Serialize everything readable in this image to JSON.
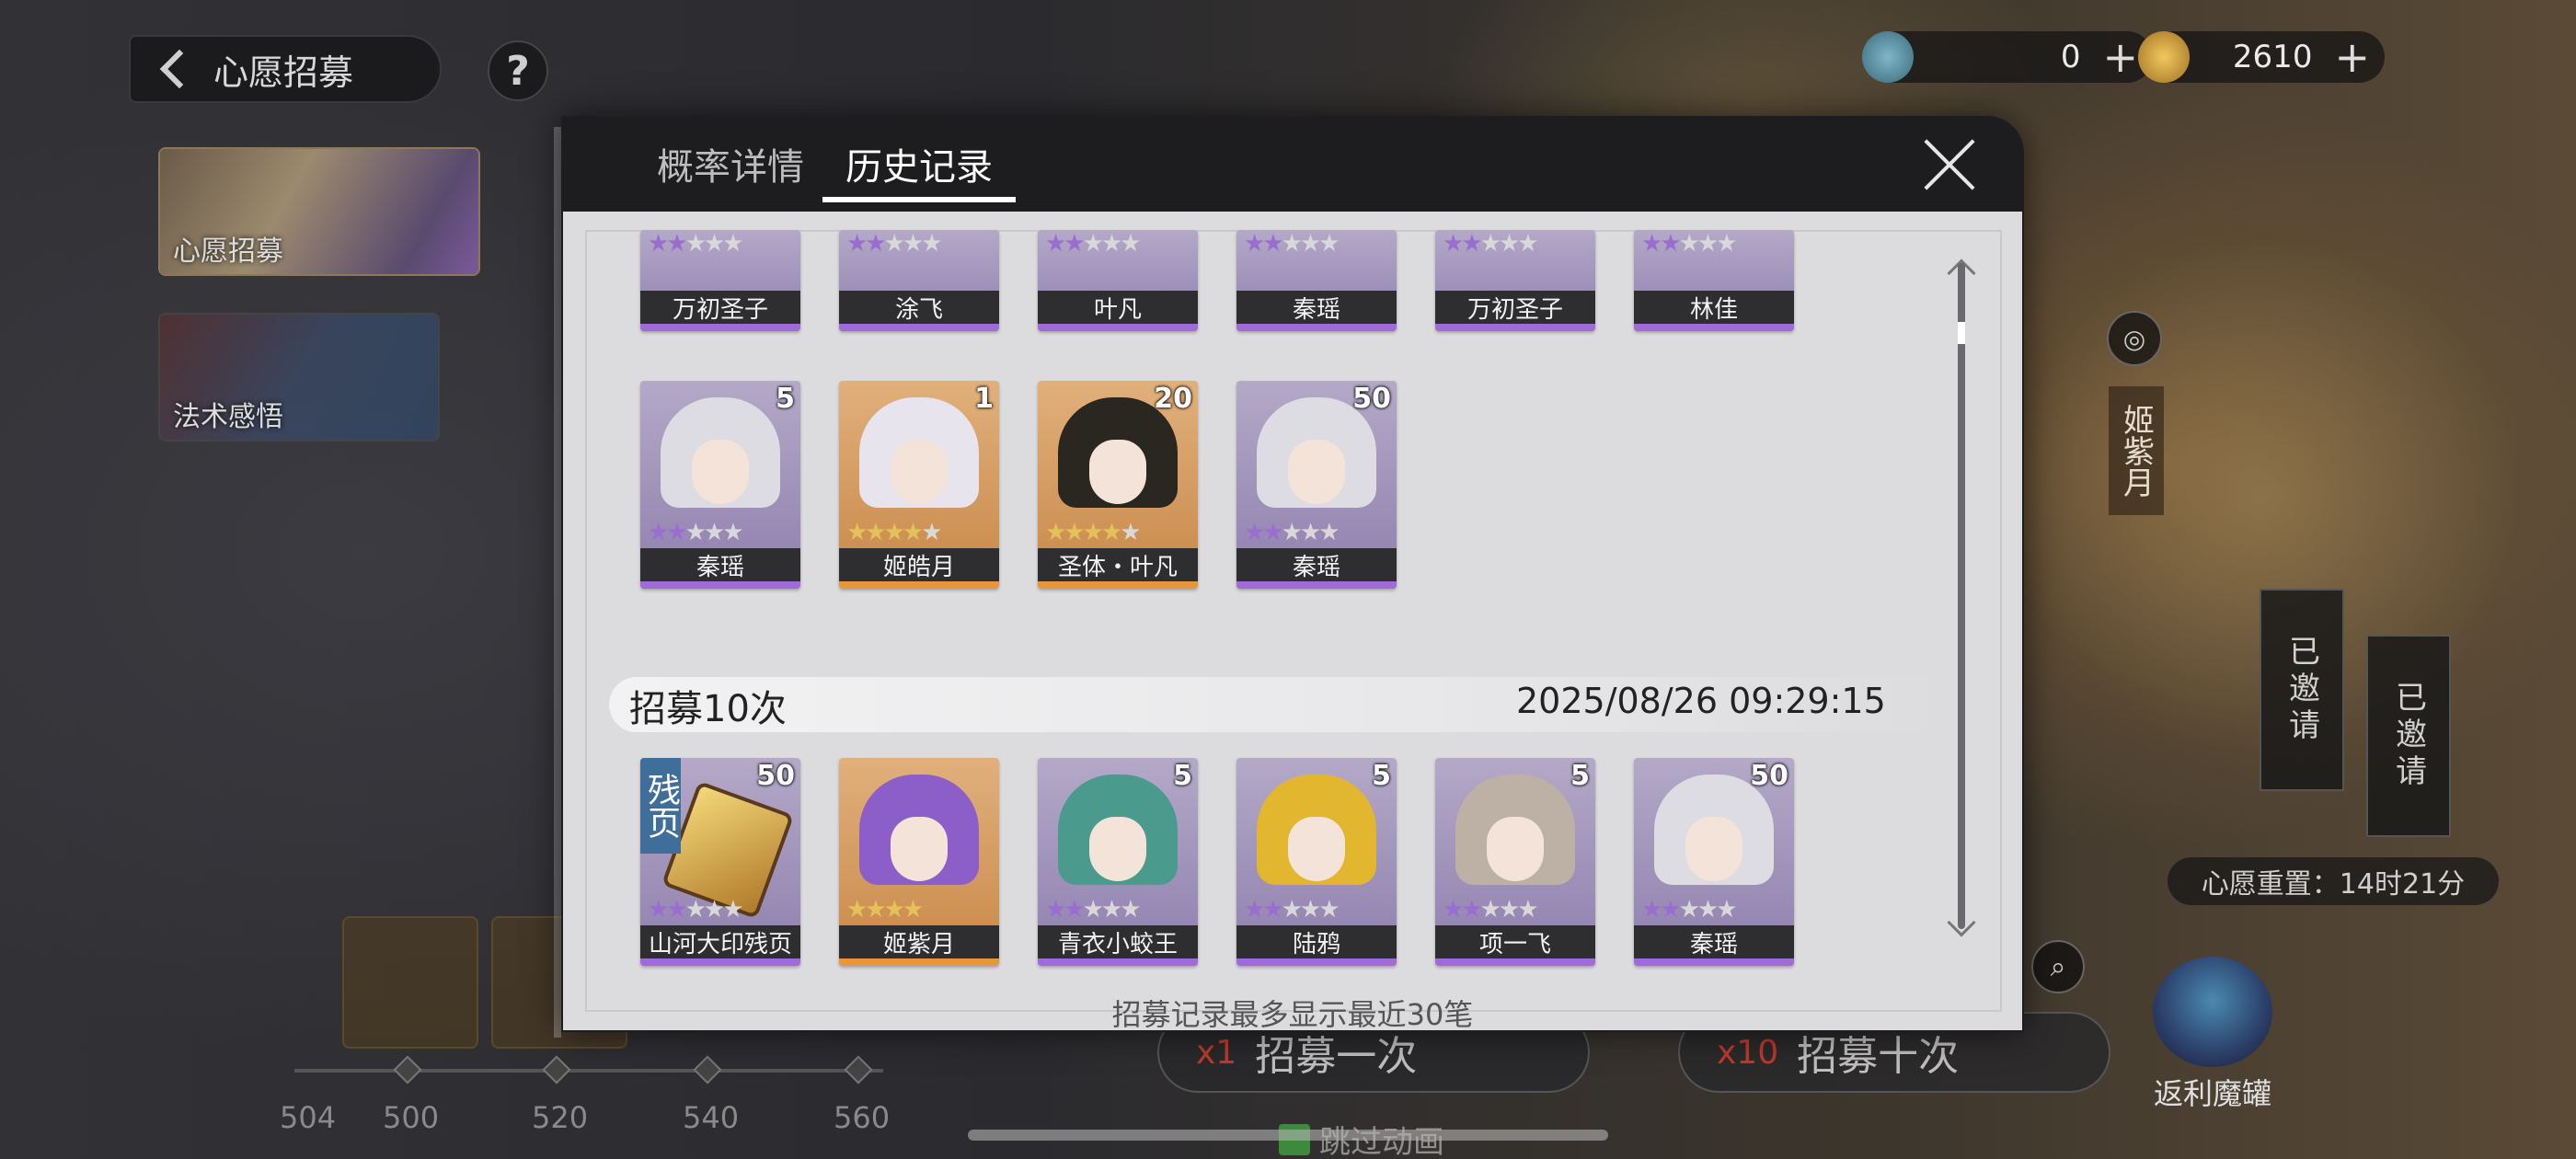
{
  "header": {
    "back_title": "心愿招募",
    "help_label": "?"
  },
  "side_tabs": [
    {
      "label": "心愿招募",
      "selected": true
    },
    {
      "label": "法术感悟",
      "selected": false
    }
  ],
  "currencies": [
    {
      "icon": "wish-coin-icon",
      "value": "0",
      "plus": "+"
    },
    {
      "icon": "gold-coin-icon",
      "value": "2610",
      "plus": "+"
    }
  ],
  "featured_character": "姬紫月",
  "wish_reset": "心愿重置：14时21分",
  "invited_badges": [
    "已邀请",
    "已邀请"
  ],
  "progress": {
    "labels": [
      "504",
      "500",
      "520",
      "540",
      "560"
    ]
  },
  "bottom_buttons": [
    {
      "count": "x1",
      "label": "招募一次"
    },
    {
      "count": "x10",
      "label": "招募十次"
    }
  ],
  "magic_jar_label": "返利魔罐",
  "skip_animation_label": "跳过动画",
  "modal": {
    "tabs": [
      {
        "label": "概率详情",
        "active": false
      },
      {
        "label": "历史记录",
        "active": true
      }
    ],
    "top_row_partial": [
      {
        "name": "万初圣子",
        "rarity": "purple"
      },
      {
        "name": "涂飞",
        "rarity": "purple"
      },
      {
        "name": "叶凡",
        "rarity": "purple"
      },
      {
        "name": "秦瑶",
        "rarity": "purple"
      },
      {
        "name": "万初圣子",
        "rarity": "purple"
      },
      {
        "name": "林佳",
        "rarity": "purple"
      }
    ],
    "second_row": [
      {
        "name": "秦瑶",
        "count": "5",
        "rarity": "purple",
        "stars": 2
      },
      {
        "name": "姬皓月",
        "count": "1",
        "rarity": "orange",
        "stars": 4
      },
      {
        "name": "圣体・叶凡",
        "count": "20",
        "rarity": "orange",
        "stars": 4
      },
      {
        "name": "秦瑶",
        "count": "50",
        "rarity": "purple",
        "stars": 2
      }
    ],
    "record": {
      "title": "招募10次",
      "time": "2025/08/26 09:29:15",
      "cards": [
        {
          "name": "山河大印残页",
          "count": "50",
          "rarity": "purple",
          "fragment_tag": "残页",
          "stars": 2
        },
        {
          "name": "姬紫月",
          "count": "",
          "rarity": "orange",
          "stars": 4
        },
        {
          "name": "青衣小蛟王",
          "count": "5",
          "rarity": "purple",
          "stars": 2
        },
        {
          "name": "陆鸦",
          "count": "5",
          "rarity": "purple",
          "stars": 2
        },
        {
          "name": "项一飞",
          "count": "5",
          "rarity": "purple",
          "stars": 2
        },
        {
          "name": "秦瑶",
          "count": "50",
          "rarity": "purple",
          "stars": 2
        }
      ]
    },
    "footer_note": "招募记录最多显示最近30笔"
  },
  "colors": {
    "purple_rarity": "#a06ad8",
    "orange_rarity": "#e8963c",
    "modal_bg": "#dcdcde",
    "header_bg": "#1d1d1f"
  }
}
